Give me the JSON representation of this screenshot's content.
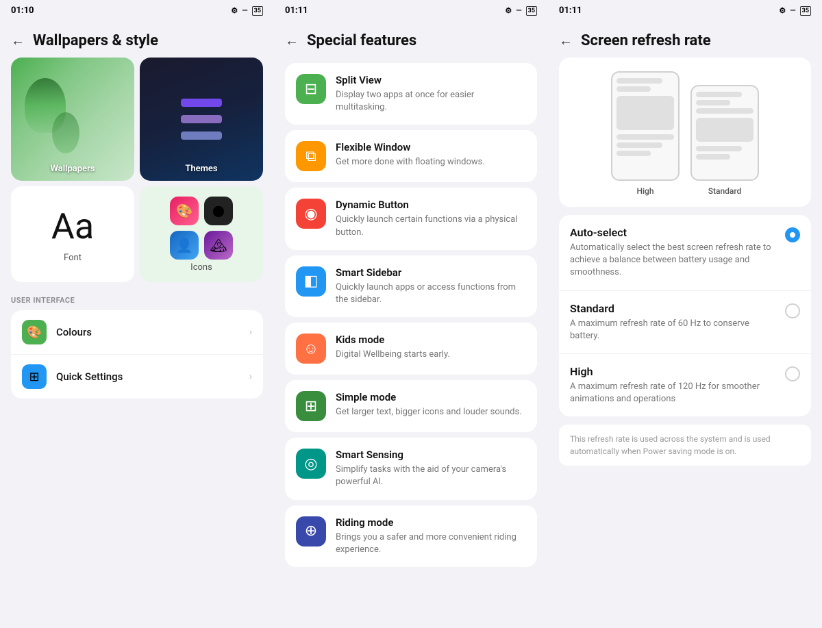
{
  "panel1": {
    "status_time": "01:10",
    "title": "Wallpapers & style",
    "wallpaper1_label": "Wallpapers",
    "wallpaper2_label": "Themes",
    "font_label": "Font",
    "font_display": "Aa",
    "icons_label": "Icons",
    "section_ui": "USER INTERFACE",
    "colours_label": "Colours",
    "quick_settings_label": "Quick Settings"
  },
  "panel2": {
    "status_time": "01:11",
    "title": "Special features",
    "features": [
      {
        "title": "Split View",
        "desc": "Display two apps at once for easier multitasking.",
        "icon_color": "green",
        "icon": "⊟"
      },
      {
        "title": "Flexible Window",
        "desc": "Get more done with floating windows.",
        "icon_color": "orange",
        "icon": "⧉"
      },
      {
        "title": "Dynamic Button",
        "desc": "Quickly launch certain functions via a physical button.",
        "icon_color": "red-orange",
        "icon": "◉"
      },
      {
        "title": "Smart Sidebar",
        "desc": "Quickly launch apps or access functions from the sidebar.",
        "icon_color": "blue",
        "icon": "◧"
      },
      {
        "title": "Kids mode",
        "desc": "Digital Wellbeing starts early.",
        "icon_color": "peach",
        "icon": "☺"
      },
      {
        "title": "Simple mode",
        "desc": "Get larger text, bigger icons and louder sounds.",
        "icon_color": "dark-green",
        "icon": "⊞"
      },
      {
        "title": "Smart Sensing",
        "desc": "Simplify tasks with the aid of your camera's powerful AI.",
        "icon_color": "teal",
        "icon": "◎"
      },
      {
        "title": "Riding mode",
        "desc": "Brings you a safer and more convenient riding experience.",
        "icon_color": "blue-purple",
        "icon": "⊕"
      }
    ]
  },
  "panel3": {
    "status_time": "01:11",
    "title": "Screen refresh rate",
    "preview_label_high": "High",
    "preview_label_standard": "Standard",
    "options": [
      {
        "title": "Auto-select",
        "desc": "Automatically select the best screen refresh rate to achieve a balance between battery usage and smoothness.",
        "selected": true
      },
      {
        "title": "Standard",
        "desc": "A maximum refresh rate of 60 Hz to conserve battery.",
        "selected": false
      },
      {
        "title": "High",
        "desc": "A maximum refresh rate of 120 Hz for smoother animations and operations",
        "selected": false
      }
    ],
    "note": "This refresh rate is used across the system and is used automatically when Power saving mode is on."
  }
}
